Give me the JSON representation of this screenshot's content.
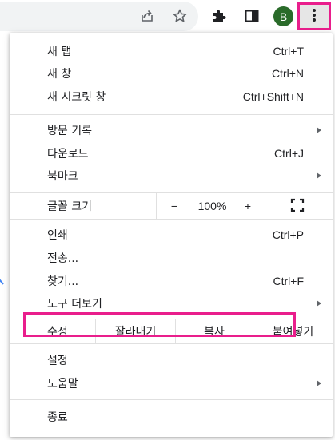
{
  "toolbar": {
    "avatar_letter": "B",
    "icons": [
      "share-icon",
      "star-icon",
      "extensions-icon",
      "side-panel-icon",
      "more-vert-icon"
    ],
    "highlight_color": "#e91e8c",
    "avatar_color": "#2a6b2a"
  },
  "menu": {
    "new_tab": {
      "label": "새 탭",
      "shortcut": "Ctrl+T"
    },
    "new_window": {
      "label": "새 창",
      "shortcut": "Ctrl+N"
    },
    "new_incognito": {
      "label": "새 시크릿 창",
      "shortcut": "Ctrl+Shift+N"
    },
    "history": {
      "label": "방문 기록"
    },
    "downloads": {
      "label": "다운로드",
      "shortcut": "Ctrl+J"
    },
    "bookmarks": {
      "label": "북마크"
    },
    "zoom": {
      "label": "글꼴 크기",
      "minus": "−",
      "value": "100%",
      "plus": "+"
    },
    "print": {
      "label": "인쇄",
      "shortcut": "Ctrl+P"
    },
    "cast": {
      "label": "전송..."
    },
    "find": {
      "label": "찾기...",
      "shortcut": "Ctrl+F"
    },
    "more_tools": {
      "label": "도구 더보기"
    },
    "edit": {
      "label": "수정",
      "cut": "잘라내기",
      "copy": "복사",
      "paste": "붙여넣기"
    },
    "settings": {
      "label": "설정"
    },
    "help": {
      "label": "도움말"
    },
    "exit": {
      "label": "종료"
    }
  }
}
